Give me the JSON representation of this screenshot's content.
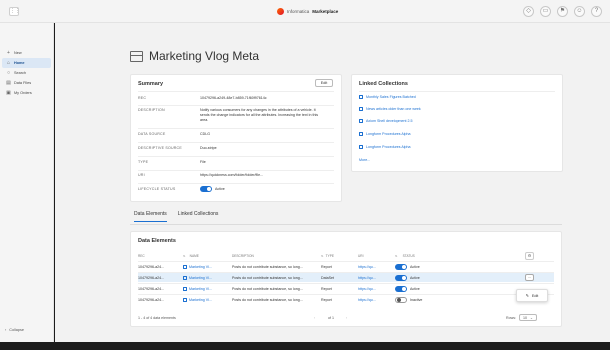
{
  "brand": {
    "name": "Informatica",
    "product": "Marketplace"
  },
  "top_icons": [
    "tag-icon",
    "cart-icon",
    "flag-icon",
    "user-icon",
    "help-icon"
  ],
  "sidebar": {
    "items": [
      {
        "label": "New",
        "icon": "plus-icon"
      },
      {
        "label": "Home",
        "icon": "home-icon",
        "active": true
      },
      {
        "label": "Search",
        "icon": "search-icon"
      },
      {
        "label": "Data Files",
        "icon": "files-icon"
      },
      {
        "label": "My Orders",
        "icon": "orders-icon"
      }
    ],
    "collapse_label": "Collapse"
  },
  "page": {
    "title": "Marketing Vlog Meta"
  },
  "summary": {
    "title": "Summary",
    "edit_label": "Edit",
    "rows": [
      {
        "label": "REC",
        "value": "10479296-a249-48e7-b859-71f60f97614c"
      },
      {
        "label": "DESCRIPTION",
        "value": "Notify various consumers for any changes in the attributes of a vehicle. It sends the change indicators for all the attributes. Increasing the text in this area."
      },
      {
        "label": "DATA SOURCE",
        "value": "CDLG"
      },
      {
        "label": "DESCRIPTIVE SOURCE",
        "value": "Duo-stripe"
      },
      {
        "label": "TYPE",
        "value": "File"
      },
      {
        "label": "URI",
        "value": "https://quickness.com/folder/folder/file..."
      },
      {
        "label": "LIFECYCLE STATUS",
        "value": "Active"
      }
    ]
  },
  "linked_collections": {
    "title": "Linked Collections",
    "items": [
      "Monthly Sales Figures Batched",
      "News articles older than one week",
      "Axiom Shell development 2.5",
      "Longform Procedures Alpha",
      "Longform Procedures Alpha"
    ],
    "more_label": "More..."
  },
  "tabs": [
    {
      "label": "Data Elements",
      "active": true
    },
    {
      "label": "Linked Collections",
      "active": false
    }
  ],
  "data_elements": {
    "title": "Data Elements",
    "columns": [
      "REC",
      "NAME",
      "DESCRIPTION",
      "TYPE",
      "URI",
      "STATUS"
    ],
    "rows": [
      {
        "rec": "10479296-a24...",
        "name": "Marketing Vl...",
        "description": "Posts do not contribute substance, so long...",
        "type": "Report",
        "uri": "https://qu...",
        "status": "Active",
        "status_on": true
      },
      {
        "rec": "10479296-a24...",
        "name": "Marketing Vl...",
        "description": "Posts do not contribute substance, so long...",
        "type": "DataSet",
        "uri": "https://qu...",
        "status": "Active",
        "status_on": true
      },
      {
        "rec": "10479296-a24...",
        "name": "Marketing Vl...",
        "description": "Posts do not contribute substance, so long...",
        "type": "Report",
        "uri": "https://qu...",
        "status": "Active",
        "status_on": true
      },
      {
        "rec": "10479296-a24...",
        "name": "Marketing Vl...",
        "description": "Posts do not contribute substance, so long...",
        "type": "Report",
        "uri": "https://qu...",
        "status": "Inactive",
        "status_on": false
      }
    ],
    "row_menu": {
      "edit_label": "Edit"
    },
    "pager": {
      "range_label": "1 - 4 of 4 data elements",
      "page_label": "of 1",
      "rows_label": "Rows:",
      "rows_value": "10"
    }
  },
  "colors": {
    "accent": "#1a6fd1",
    "hover_row": "#e3effa"
  }
}
